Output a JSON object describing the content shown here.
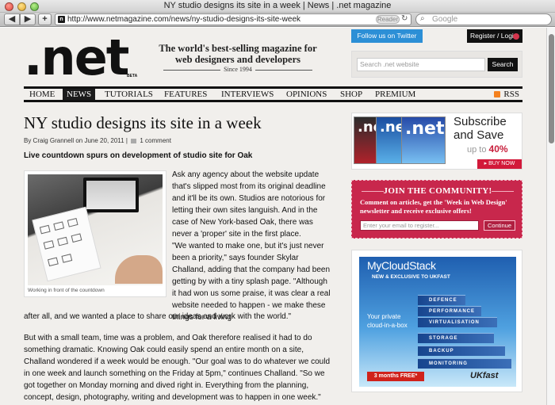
{
  "browser": {
    "title": "NY studio designs its site in a week | News | .net magazine",
    "add_tab": "+",
    "back": "◀",
    "forward": "▶",
    "url": "http://www.netmagazine.com/news/ny-studio-designs-its-site-week",
    "reader_label": "Reader",
    "reload": "↻",
    "search_placeholder": "Google"
  },
  "header": {
    "logo": ".net",
    "logo_badge": "BETA",
    "tagline": "The world's best-selling magazine for web designers and developers",
    "since": "Since 1994",
    "twitter": "Follow us on Twitter",
    "login": "Register / Login",
    "search_placeholder": "Search .net website",
    "search_button": "Search"
  },
  "nav": {
    "items": [
      "HOME",
      "NEWS",
      "TUTORIALS",
      "FEATURES",
      "INTERVIEWS",
      "OPINIONS",
      "SHOP",
      "PREMIUM"
    ],
    "active": "NEWS",
    "rss": "RSS"
  },
  "article": {
    "headline": "NY studio designs its site in a week",
    "byline": "By Craig Grannell on June 20, 2011 |",
    "comments": "1 comment",
    "standfirst": "Live countdown spurs on development of studio site for Oak",
    "caption": "Working in front of the countdown",
    "p1": "Ask any agency about the website update that's slipped most from its original deadline and it'll be its own. Studios are notorious for letting their own sites languish. And in the case of New York-based Oak, there was never a 'proper' site in the first place.",
    "p2": "\"We wanted to make one, but it's just never been a priority,\" says founder Skylar Challand, adding that the company had been getting by with a tiny splash page. \"Although it had won us some praise, it was clear a real website needed to happen - we make these things for a living",
    "p2b": "after all, and we wanted a place to share our ideas and work with the world.\"",
    "p3": "But with a small team, time was a problem, and Oak therefore realised it had to do something dramatic. Knowing Oak could easily spend an entire month on a site, Challand wondered if a week would be enough. \"Our goal was to do whatever we could in one week and launch something on the Friday at 5pm,\" continues Challand. \"So we got together on Monday morning and dived right in. Everything from the planning, concept, design, photography, writing and development was to happen in one week.\""
  },
  "sidebar": {
    "subscribe": {
      "title": "Subscribe",
      "save": "and Save",
      "upto": "up to",
      "percent": "40%",
      "buy": "▸ BUY NOW",
      "cover_logo": ".net"
    },
    "community": {
      "title": "JOIN THE COMMUNITY!",
      "text": "Comment on articles, get the 'Week in Web Design' newsletter and receive exclusive offers!",
      "placeholder": "Enter your email to register...",
      "button": "Continue"
    },
    "ad": {
      "title": "MyCloudStack",
      "subtitle": "NEW & EXCLUSIVE TO UKFAST",
      "copy": "Your private cloud-in-a-box",
      "strips": [
        "DEFENCE",
        "PERFORMANCE",
        "VIRTUALISATION",
        "STORAGE",
        "BACKUP",
        "MONITORING"
      ],
      "cta": "3 months FREE*",
      "brand": "UKfast"
    }
  },
  "colors": {
    "accent": "#c8274c",
    "twitter": "#2c8fd6",
    "rss": "#f4811f",
    "page_bg": "#f1efec"
  }
}
